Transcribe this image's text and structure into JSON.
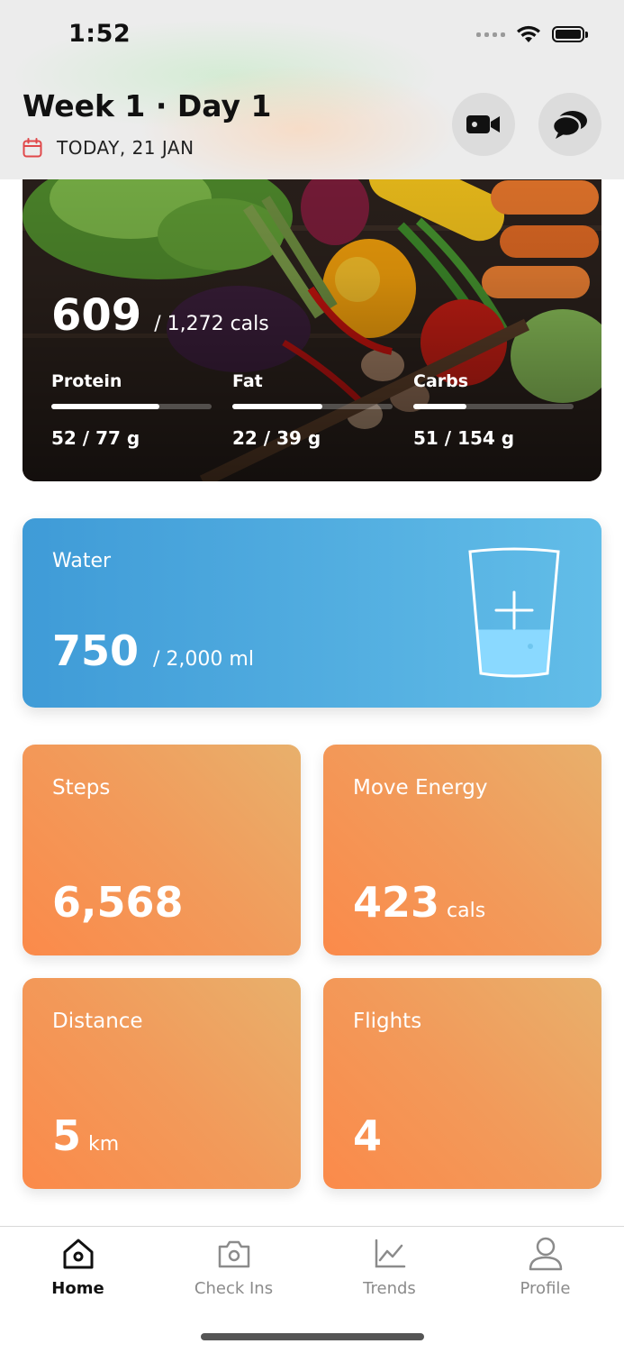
{
  "status_bar": {
    "time": "1:52"
  },
  "header": {
    "title": "Week 1 · Day 1",
    "date": "TODAY, 21 JAN",
    "icons": [
      "calendar-icon",
      "video-camera-icon",
      "chat-bubbles-icon"
    ]
  },
  "nutrition": {
    "calories_consumed": "609",
    "calories_goal": "/ 1,272 cals",
    "macros": [
      {
        "label": "Protein",
        "value": "52 / 77 g",
        "progress": 0.675
      },
      {
        "label": "Fat",
        "value": "22 / 39 g",
        "progress": 0.564
      },
      {
        "label": "Carbs",
        "value": "51 / 154 g",
        "progress": 0.331
      }
    ]
  },
  "water": {
    "label": "Water",
    "value": "750",
    "goal": "/ 2,000 ml",
    "progress": 0.375,
    "icon": "water-glass-plus-icon"
  },
  "activity": {
    "steps": {
      "label": "Steps",
      "value": "6,568"
    },
    "move_energy": {
      "label": "Move Energy",
      "value": "423",
      "unit": "cals"
    },
    "distance": {
      "label": "Distance",
      "value": "5",
      "unit": "km"
    },
    "flights": {
      "label": "Flights",
      "value": "4"
    }
  },
  "tabbar": {
    "tabs": [
      {
        "label": "Home",
        "icon": "home-icon",
        "active": true
      },
      {
        "label": "Check Ins",
        "icon": "camera-icon",
        "active": false
      },
      {
        "label": "Trends",
        "icon": "trend-chart-icon",
        "active": false
      },
      {
        "label": "Profile",
        "icon": "person-icon",
        "active": false
      }
    ]
  },
  "colors": {
    "water_gradient": [
      "#3f9bd7",
      "#62bde8"
    ],
    "activity_gradient": [
      "#fb8a4a",
      "#e8b06c"
    ],
    "calendar_accent": "#e0484a"
  }
}
